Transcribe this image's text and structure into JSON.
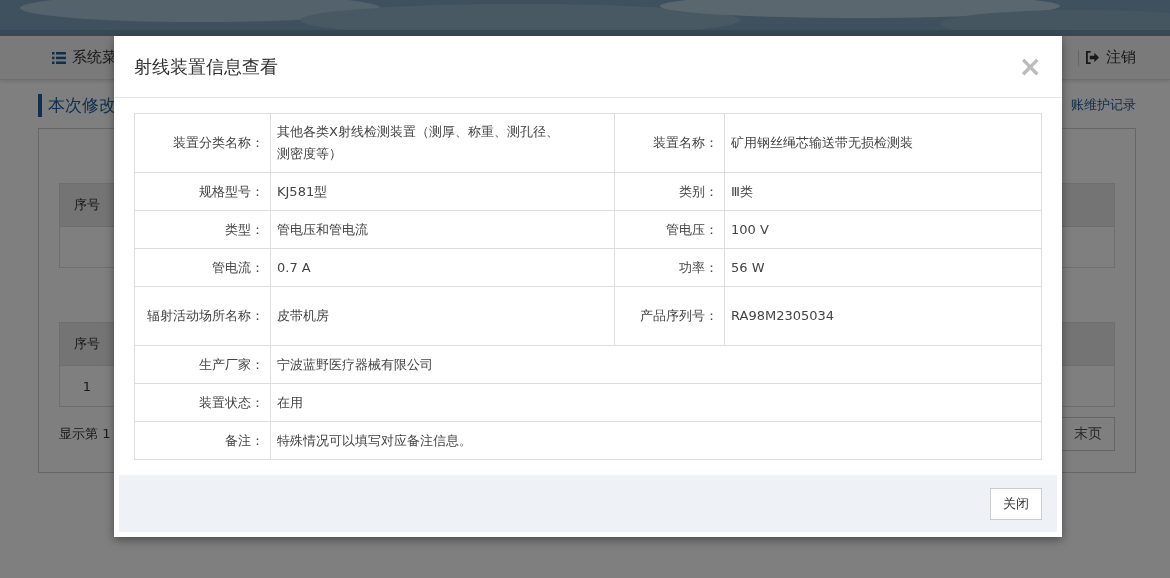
{
  "background": {
    "nav": {
      "menu_label": "系统菜",
      "logout_label": "注销"
    },
    "heading": "本次修改",
    "link": "账维护记录",
    "tables": [
      {
        "index_header": "序号",
        "rows": [
          {}
        ]
      },
      {
        "index_header": "序号",
        "rows": [
          {
            "index": "1"
          }
        ]
      }
    ],
    "pagination": {
      "info": "显示第 1",
      "last_button": "末页"
    }
  },
  "dialog": {
    "title": "射线装置信息查看",
    "close_icon": "×",
    "rows": [
      {
        "fields": [
          {
            "label": "装置分类名称：",
            "value": "其他各类X射线检测装置（测厚、称重、测孔径、测密度等）"
          },
          {
            "label": "装置名称：",
            "value": "矿用钢丝绳芯输送带无损检测装"
          }
        ]
      },
      {
        "fields": [
          {
            "label": "规格型号：",
            "value": "KJ581型"
          },
          {
            "label": "类别：",
            "value": "Ⅲ类"
          }
        ]
      },
      {
        "fields": [
          {
            "label": "类型：",
            "value": "管电压和管电流"
          },
          {
            "label": "管电压：",
            "value": "100 V"
          }
        ]
      },
      {
        "fields": [
          {
            "label": "管电流：",
            "value": "0.7 A"
          },
          {
            "label": "功率：",
            "value": "56 W"
          }
        ]
      },
      {
        "fields": [
          {
            "label": "辐射活动场所名称：",
            "value": "皮带机房"
          },
          {
            "label": "产品序列号：",
            "value": "RA98M2305034"
          }
        ]
      },
      {
        "fields": [
          {
            "label": "生产厂家：",
            "value": "宁波蓝野医疗器械有限公司"
          }
        ]
      },
      {
        "fields": [
          {
            "label": "装置状态：",
            "value": "在用"
          }
        ]
      },
      {
        "fields": [
          {
            "label": "备注：",
            "value": "特殊情况可以填写对应备注信息。"
          }
        ]
      }
    ],
    "close_button": "关闭"
  }
}
